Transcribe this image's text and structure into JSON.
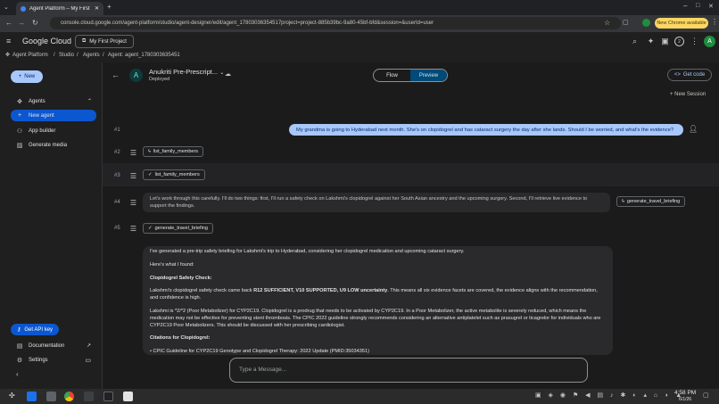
{
  "browser": {
    "tab_title": "Agent Platform – My First",
    "url": "console.cloud.google.com/agent-platform/studio/agent-designer/edit/agent_17803036354517project=project-885b39bc-9a80-45bf-bfd&session=&userId=user",
    "chrome_notice": "New Chrome available"
  },
  "header": {
    "logo": "Google Cloud",
    "project": "My First Project"
  },
  "breadcrumb": {
    "platform": "Agent Platform",
    "studio": "Studio",
    "agents": "Agents",
    "current": "Agent: agent_1780303635451"
  },
  "sidebar": {
    "new_label": "New",
    "section_label": "Agents",
    "items": [
      {
        "label": "New agent"
      },
      {
        "label": "App builder"
      },
      {
        "label": "Generate media"
      }
    ],
    "get_api_key": "Get API key",
    "documentation": "Documentation",
    "settings": "Settings"
  },
  "agent": {
    "avatar_letter": "A",
    "name": "Anukriti Pre-Prescript...",
    "status": "Deployed"
  },
  "toolbar": {
    "flow_tab": "Flow",
    "preview_tab": "Preview",
    "get_code": "Get code",
    "new_session": "+ New Session"
  },
  "conversation": {
    "turns": [
      {
        "no": "#1",
        "user_message": "My grandma is going to Hyderabad next month. She's on clopidogrel and has cataract surgery the day after she lands. Should I be worried, and what's the evidence?"
      },
      {
        "no": "#2",
        "function": "list_family_members"
      },
      {
        "no": "#3",
        "function": "list_family_members"
      },
      {
        "no": "#4",
        "text": "Let's work through this carefully. I'll do two things: first, I'll run a safety check on Lakshmi's clopidogrel against her South Asian ancestry and the upcoming surgery. Second, I'll retrieve live evidence to support the findings.",
        "function": "generate_travel_briefing"
      },
      {
        "no": "#5",
        "function": "generate_travel_briefing"
      }
    ],
    "final_response": {
      "intro": "I've generated a pre-trip safety briefing for Lakshmi's trip to Hyderabad, considering her clopidogrel medication and upcoming cataract surgery.",
      "found": "Here's what I found:",
      "heading_safety": "Clopidogrel Safety Check:",
      "safety_pre": "Lakshmi's clopidogrel safety check came back ",
      "safety_bold": "R12 SUFFICIENT, V10 SUPPORTED, U9 LOW uncertainty",
      "safety_post": ". This means all six evidence facets are covered, the evidence aligns with the recommendation, and confidence is high.",
      "detail": "Lakshmi is *2/*2 (Poor Metabolizer) for CYP2C19. Clopidogrel is a prodrug that needs to be activated by CYP2C19. In a Poor Metabolizer, the active metabolite is severely reduced, which means the medication may not be effective for preventing stent thrombosis. The CPIC 2022 guideline strongly recommends considering an alternative antiplatelet such as prasugrel or ticagrelor for individuals who are CYP2C19 Poor Metabolizers. This should be discussed with her prescribing cardiologist.",
      "heading_citations": "Citations for Clopidogrel:",
      "citation_1": "CPIC Guideline for CYP2C19 Genotype and Clopidogrel Therapy: 2022 Update (PMID:35034351)"
    },
    "composer_placeholder": "Type a Message..."
  },
  "system": {
    "time": "4:58 PM",
    "date": "6/1/26"
  },
  "colors": {
    "accent": "#a8c7fa",
    "active_nav": "#0b57d0",
    "background": "#1f1f1f"
  }
}
